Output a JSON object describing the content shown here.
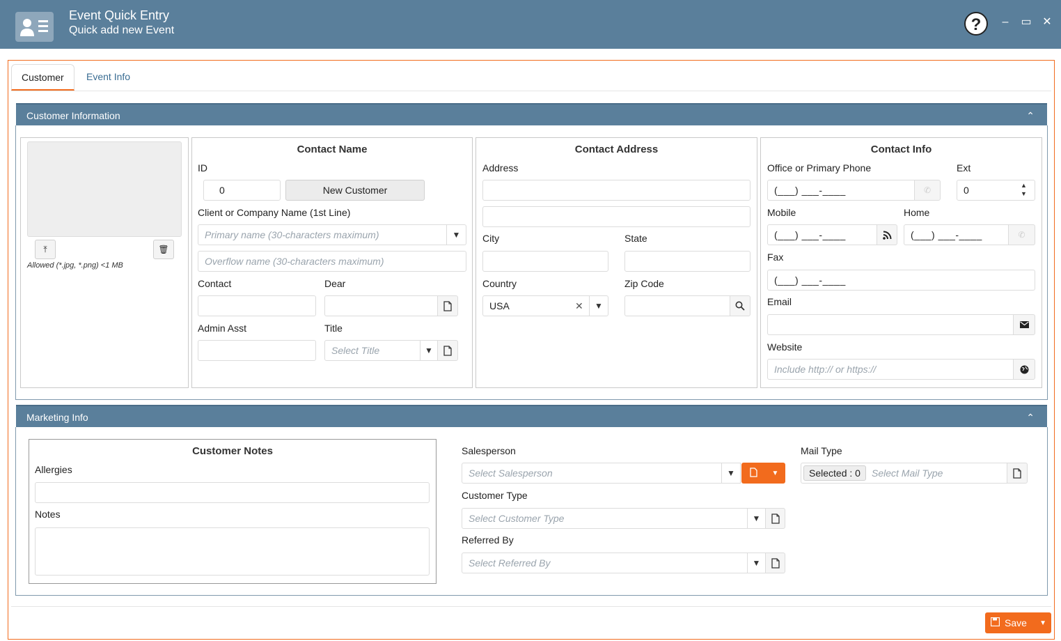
{
  "window": {
    "title": "Event Quick Entry",
    "subtitle": "Quick add new Event",
    "help": "?",
    "minimize": "–",
    "maximize": "▭",
    "close": "✕"
  },
  "tabs": [
    {
      "label": "Customer",
      "active": true
    },
    {
      "label": "Event Info",
      "active": false
    }
  ],
  "customer_info": {
    "section_title": "Customer Information",
    "collapse_glyph": "⌃",
    "photo": {
      "upload_glyph": "⤒",
      "delete_glyph": "🗑",
      "allowed_note": "Allowed (*.jpg, *.png) <1 MB"
    },
    "contact_name": {
      "title": "Contact Name",
      "id_label": "ID",
      "id_value": "0",
      "new_customer_button": "New Customer",
      "company_label": "Client or Company Name (1st Line)",
      "primary_placeholder": "Primary name (30-characters maximum)",
      "overflow_placeholder": "Overflow name (30-characters maximum)",
      "contact_label": "Contact",
      "dear_label": "Dear",
      "admin_label": "Admin Asst",
      "title_label": "Title",
      "title_placeholder": "Select Title"
    },
    "contact_address": {
      "title": "Contact Address",
      "address_label": "Address",
      "city_label": "City",
      "state_label": "State",
      "country_label": "Country",
      "country_value": "USA",
      "clear_glyph": "✕",
      "zip_label": "Zip Code"
    },
    "contact_info": {
      "title": "Contact Info",
      "office_label": "Office or Primary Phone",
      "ext_label": "Ext",
      "ext_value": "0",
      "phone_mask": "(___) ___-____",
      "mobile_label": "Mobile",
      "home_label": "Home",
      "fax_label": "Fax",
      "email_label": "Email",
      "website_label": "Website",
      "website_placeholder": "Include http:// or https://"
    }
  },
  "marketing_info": {
    "section_title": "Marketing Info",
    "collapse_glyph": "⌃",
    "notes_panel": {
      "title": "Customer Notes",
      "allergies_label": "Allergies",
      "notes_label": "Notes"
    },
    "salesperson_label": "Salesperson",
    "salesperson_placeholder": "Select Salesperson",
    "customer_type_label": "Customer Type",
    "customer_type_placeholder": "Select Customer Type",
    "referred_by_label": "Referred By",
    "referred_by_placeholder": "Select Referred By",
    "mail_type_label": "Mail Type",
    "mail_type_selected": "Selected : 0",
    "mail_type_placeholder": "Select Mail Type"
  },
  "footer": {
    "save_label": "Save"
  },
  "colors": {
    "header": "#5a7f9b",
    "accent": "#f26b1d"
  }
}
